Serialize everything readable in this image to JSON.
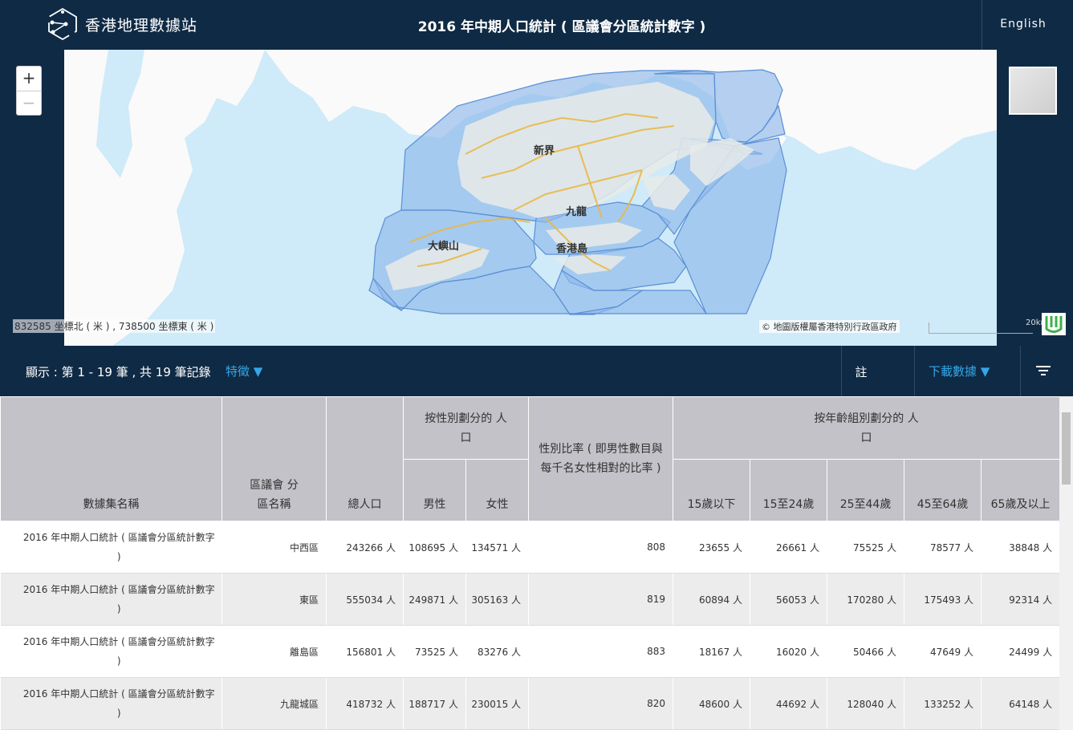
{
  "header": {
    "site_name": "香港地理數據站",
    "title": "2016 年中期人口統計 ( 區議會分區統計數字 )",
    "language": "English"
  },
  "map": {
    "zoom_in": "+",
    "zoom_out": "−",
    "labels": {
      "new_territories": "新界",
      "kowloon": "九龍",
      "hk_island": "香港島",
      "lantau": "大嶼山"
    },
    "coords": "832585 坐標北 ( 米 ) , 738500 坐標東 ( 米 )",
    "attribution": "© 地圖版權屬香港特別行政區政府",
    "scale": "20km"
  },
  "toolbar": {
    "record_info": "顯示 : 第 1 - 19 筆 , 共 19 筆記錄",
    "features": "特徵 ▼",
    "note": "註",
    "download": "下載數據 ▼"
  },
  "table": {
    "headers": {
      "dataset": "數據集名稱",
      "district": "區議會 分區名稱",
      "total": "總人口",
      "by_sex": "按性別劃分的 人口",
      "male": "男性",
      "female": "女性",
      "ratio": "性別比率 ( 即男性數目與每千名女性相對的比率 )",
      "by_age": "按年齡組別劃分的 人口",
      "age_0_14": "15歲以下",
      "age_15_24": "15至24歲",
      "age_25_44": "25至44歲",
      "age_45_64": "45至64歲",
      "age_65": "65歲及以上"
    },
    "rows": [
      {
        "dataset": "2016 年中期人口統計 ( 區議會分區統計數字 )",
        "district": "中西區",
        "total": "243266 人",
        "male": "108695 人",
        "female": "134571 人",
        "ratio": "808",
        "a1": "23655 人",
        "a2": "26661 人",
        "a3": "75525 人",
        "a4": "78577 人",
        "a5": "38848 人"
      },
      {
        "dataset": "2016 年中期人口統計 ( 區議會分區統計數字 )",
        "district": "東區",
        "total": "555034 人",
        "male": "249871 人",
        "female": "305163 人",
        "ratio": "819",
        "a1": "60894 人",
        "a2": "56053 人",
        "a3": "170280 人",
        "a4": "175493 人",
        "a5": "92314 人"
      },
      {
        "dataset": "2016 年中期人口統計 ( 區議會分區統計數字 )",
        "district": "離島區",
        "total": "156801 人",
        "male": "73525 人",
        "female": "83276 人",
        "ratio": "883",
        "a1": "18167 人",
        "a2": "16020 人",
        "a3": "50466 人",
        "a4": "47649 人",
        "a5": "24499 人"
      },
      {
        "dataset": "2016 年中期人口統計 ( 區議會分區統計數字 )",
        "district": "九龍城區",
        "total": "418732 人",
        "male": "188717 人",
        "female": "230015 人",
        "ratio": "820",
        "a1": "48600 人",
        "a2": "44692 人",
        "a3": "128040 人",
        "a4": "133252 人",
        "a5": "64148 人"
      }
    ]
  },
  "colors": {
    "nav_bg": "#0f2a45",
    "accent": "#35a7e6",
    "header_cell": "#c2c2c8",
    "sea": "#cfeaf8",
    "district_fill": "#8fb8ea"
  }
}
